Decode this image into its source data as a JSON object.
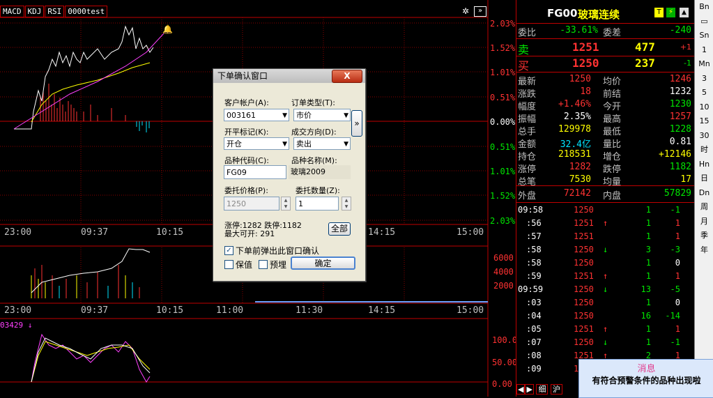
{
  "tabs": [
    "MACD",
    "KDJ",
    "RSI",
    "0000test"
  ],
  "price_axis_right": [
    "2.03%",
    "1.52%",
    "1.01%",
    "0.51%",
    "0.00%",
    "0.51%",
    "1.01%",
    "1.52%",
    "2.03%"
  ],
  "time_axis_top": [
    "23:00",
    "09:37",
    "10:15",
    "14:15",
    "15:00"
  ],
  "time_axis_mid": [
    "23:00",
    "09:37",
    "10:15",
    "11:00",
    "11:30",
    "14:15",
    "15:00"
  ],
  "volume_axis": [
    "6000",
    "4000",
    "2000"
  ],
  "indicator_label": "03429",
  "indicator_axis": [
    "100.0",
    "50.00",
    "0.00"
  ],
  "quote": {
    "symbol": "FG00",
    "name": "玻璃连续",
    "wei_bi_label": "委比",
    "wei_bi": "-33.61%",
    "wei_cha_label": "委差",
    "wei_cha": "-240",
    "sell_label": "卖",
    "sell_price": "1251",
    "sell_vol": "477",
    "sell_chg": "+1",
    "buy_label": "买",
    "buy_price": "1250",
    "buy_vol": "237",
    "buy_chg": "-1",
    "rows": [
      {
        "l1": "最新",
        "v1": "1250",
        "c1": "red",
        "l2": "均价",
        "v2": "1246",
        "c2": "red"
      },
      {
        "l1": "涨跌",
        "v1": "18",
        "c1": "red",
        "l2": "前结",
        "v2": "1232",
        "c2": "white"
      },
      {
        "l1": "幅度",
        "v1": "+1.46%",
        "c1": "red",
        "l2": "今开",
        "v2": "1230",
        "c2": "green"
      },
      {
        "l1": "振幅",
        "v1": "2.35%",
        "c1": "white",
        "l2": "最高",
        "v2": "1257",
        "c2": "red"
      },
      {
        "l1": "总手",
        "v1": "129978",
        "c1": "yellow",
        "l2": "最低",
        "v2": "1228",
        "c2": "green"
      },
      {
        "l1": "金额",
        "v1": "32.4亿",
        "c1": "cyan",
        "l2": "量比",
        "v2": "0.81",
        "c2": "white"
      },
      {
        "l1": "持仓",
        "v1": "218531",
        "c1": "yellow",
        "l2": "增仓",
        "v2": "+12146",
        "c2": "yellow"
      },
      {
        "l1": "涨停",
        "v1": "1282",
        "c1": "red",
        "l2": "跌停",
        "v2": "1182",
        "c2": "green"
      },
      {
        "l1": "总笔",
        "v1": "7530",
        "c1": "yellow",
        "l2": "均量",
        "v2": "17",
        "c2": "yellow"
      }
    ],
    "outer_label": "外盘",
    "outer": "72142",
    "inner_label": "内盘",
    "inner": "57829"
  },
  "ticks": [
    {
      "t": "09:58",
      "p": "1250",
      "pc": "red",
      "a": "",
      "ac": "",
      "v": "1",
      "r": "-1",
      "rc": "green"
    },
    {
      "t": ":56",
      "p": "1251",
      "pc": "red",
      "a": "↑",
      "ac": "red",
      "v": "1",
      "r": "1",
      "rc": "red"
    },
    {
      "t": ":57",
      "p": "1251",
      "pc": "red",
      "a": "",
      "ac": "",
      "v": "1",
      "r": "1",
      "rc": "red"
    },
    {
      "t": ":58",
      "p": "1250",
      "pc": "red",
      "a": "↓",
      "ac": "green",
      "v": "3",
      "r": "-3",
      "rc": "green"
    },
    {
      "t": ":58",
      "p": "1250",
      "pc": "red",
      "a": "",
      "ac": "",
      "v": "1",
      "r": "0",
      "rc": "white"
    },
    {
      "t": ":59",
      "p": "1251",
      "pc": "red",
      "a": "↑",
      "ac": "red",
      "v": "1",
      "r": "1",
      "rc": "red"
    },
    {
      "t": "09:59",
      "p": "1250",
      "pc": "red",
      "a": "↓",
      "ac": "green",
      "v": "13",
      "r": "-5",
      "rc": "green"
    },
    {
      "t": ":03",
      "p": "1250",
      "pc": "red",
      "a": "",
      "ac": "",
      "v": "1",
      "r": "0",
      "rc": "white"
    },
    {
      "t": ":04",
      "p": "1250",
      "pc": "red",
      "a": "",
      "ac": "",
      "v": "16",
      "r": "-14",
      "rc": "green"
    },
    {
      "t": ":05",
      "p": "1251",
      "pc": "red",
      "a": "↑",
      "ac": "red",
      "v": "1",
      "r": "1",
      "rc": "red"
    },
    {
      "t": ":07",
      "p": "1250",
      "pc": "red",
      "a": "↓",
      "ac": "green",
      "v": "1",
      "r": "-1",
      "rc": "green"
    },
    {
      "t": ":08",
      "p": "1251",
      "pc": "red",
      "a": "↑",
      "ac": "red",
      "v": "2",
      "r": "1",
      "rc": "red"
    },
    {
      "t": ":09",
      "p": "1250",
      "pc": "red",
      "a": "",
      "ac": "",
      "v": "",
      "r": "",
      "rc": "white"
    }
  ],
  "bottom_tabs": [
    "细",
    "沪"
  ],
  "toolbar": [
    "Bn",
    "",
    "Sn",
    "1",
    "Mn",
    "3",
    "5",
    "10",
    "15",
    "30",
    "时",
    "Hn",
    "日",
    "Dn",
    "周",
    "月",
    "季",
    "年"
  ],
  "dialog": {
    "title": "下单确认窗口",
    "close": "X",
    "account_label": "客户帐户(A):",
    "account": "003161",
    "order_type_label": "订单类型(T):",
    "order_type": "市价",
    "open_close_label": "开平标记(K):",
    "open_close": "开仓",
    "direction_label": "成交方向(D):",
    "direction": "卖出",
    "code_label": "品种代码(C):",
    "code": "FG09",
    "name_label": "品种名称(M):",
    "name": "玻璃2009",
    "price_label": "委托价格(P):",
    "price": "1250",
    "qty_label": "委托数量(Z):",
    "qty": "1",
    "limit_info": "涨停:1282 跌停:1182",
    "max_open": "最大可开: 291",
    "all_button": "全部",
    "popup_check": "下单前弹出此窗口确认",
    "preserve": "保值",
    "preset": "预埋",
    "confirm": "确定",
    "expand": "»"
  },
  "message": {
    "title": "消息",
    "body": "有符合预警条件的品种出现啦"
  }
}
